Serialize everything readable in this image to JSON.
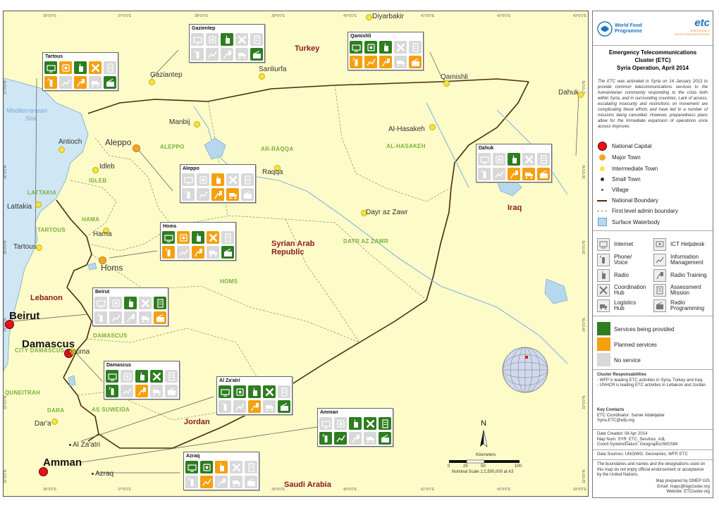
{
  "map": {
    "countries": {
      "turkey": "Turkey",
      "syria_1": "Syrian Arab",
      "syria_2": "Republic",
      "iraq": "Iraq",
      "lebanon": "Lebanon",
      "jordan": "Jordan",
      "saudi": "Saudi Arabia"
    },
    "sea_1": "Mediterranean",
    "sea_2": "Sea",
    "governorates": {
      "aleppo": "ALEPPO",
      "arraqqa": "AR-RAQQA",
      "alhasakeh": "AL-HASAKEH",
      "idleb": "IDLEB",
      "lattakia": "LATTAKIA",
      "hama": "HAMA",
      "tartous": "TARTOUS",
      "dayrazzawr": "DAYR AZ ZAWR",
      "homs": "HOMS",
      "damascus": "DAMASCUS",
      "citydamascus": "CITY DAMASCUS",
      "quneitrah": "QUNEITRAH",
      "dara": "DARA",
      "assuweida": "AS SUWEIDA"
    },
    "towns": {
      "diyarbakir": "Diyarbakir",
      "sanliurfa": "Sanliurfa",
      "gaziantep": "Gaziantep",
      "qamishli": "Qamishli",
      "dahuk": "Dahuk",
      "manbij": "Manbij",
      "alhasakeh": "Al-Hasakeh",
      "antioch": "Antioch",
      "aleppo": "Aleppo",
      "idleb": "Idleb",
      "raqqa": "Raqqa",
      "hama": "Hama",
      "lattakia": "Lattakia",
      "dayrazzawr": "Dayr az Zawr",
      "tartous": "Tartous",
      "homs": "Homs",
      "beirut": "Beirut",
      "damascus": "Damascus",
      "douma": "Douma",
      "dara": "Dar'a",
      "alzaatri": "Al Za'atri",
      "amman": "Amman",
      "azraq": "Azraq"
    },
    "coords": {
      "top": [
        "36°0'0\"E",
        "37°0'0\"E",
        "38°0'0\"E",
        "39°0'0\"E",
        "40°0'0\"E",
        "41°0'0\"E",
        "42°0'0\"E",
        "43°0'0\"E"
      ],
      "bottom": [
        "36°0'0\"E",
        "37°0'0\"E",
        "38°0'0\"E",
        "39°0'0\"E",
        "40°0'0\"E",
        "41°0'0\"E",
        "42°0'0\"E",
        "43°0'0\"E"
      ],
      "left": [
        "37°0'0\"N",
        "36°0'0\"N",
        "35°0'0\"N",
        "34°0'0\"N",
        "33°0'0\"N",
        "32°0'0\"N"
      ],
      "right": [
        "37°0'0\"N",
        "36°0'0\"N",
        "35°0'0\"N",
        "34°0'0\"N",
        "33°0'0\"N",
        "32°0'0\"N"
      ]
    },
    "north": "N",
    "scale_title": "Kilometers",
    "scale_ticks": [
      "0",
      "25",
      "50",
      "100"
    ],
    "scale_text": "Nominal Scale 1:2,500,000 at A3"
  },
  "hubs": [
    {
      "id": "gaziantep",
      "title": "Gazientep",
      "icons": [
        "n",
        "n",
        "g",
        "n",
        "n",
        "n",
        "n",
        "n",
        "n",
        "g"
      ]
    },
    {
      "id": "qamishli",
      "title": "Qamishli",
      "icons": [
        "g",
        "g",
        "g",
        "n",
        "n",
        "o",
        "o",
        "o",
        "n",
        "o"
      ]
    },
    {
      "id": "tartous",
      "title": "Tartous",
      "icons": [
        "g",
        "o",
        "g",
        "o",
        "n",
        "o",
        "n",
        "o",
        "n",
        "g"
      ]
    },
    {
      "id": "dahuk",
      "title": "Dahuk",
      "icons": [
        "n",
        "n",
        "g",
        "n",
        "n",
        "n",
        "n",
        "o",
        "o",
        "o"
      ]
    },
    {
      "id": "aleppo",
      "title": "Aleppo",
      "icons": [
        "n",
        "n",
        "o",
        "n",
        "n",
        "n",
        "n",
        "o",
        "o",
        "n"
      ]
    },
    {
      "id": "homs",
      "title": "Homs",
      "icons": [
        "g",
        "o",
        "g",
        "o",
        "n",
        "o",
        "n",
        "o",
        "n",
        "g"
      ]
    },
    {
      "id": "beirut",
      "title": "Beirut",
      "icons": [
        "n",
        "n",
        "g",
        "n",
        "g",
        "n",
        "n",
        "n",
        "n",
        "o"
      ]
    },
    {
      "id": "damascus",
      "title": "Damascus",
      "icons": [
        "g",
        "n",
        "g",
        "g",
        "n",
        "g",
        "n",
        "o",
        "n",
        "n"
      ]
    },
    {
      "id": "alzaatri",
      "title": "Al Za'atri",
      "icons": [
        "g",
        "g",
        "g",
        "g",
        "n",
        "n",
        "n",
        "o",
        "n",
        "g"
      ]
    },
    {
      "id": "amman",
      "title": "Amman",
      "icons": [
        "n",
        "n",
        "g",
        "g",
        "g",
        "g",
        "g",
        "n",
        "n",
        "g"
      ]
    },
    {
      "id": "azraq",
      "title": "Azraq",
      "icons": [
        "g",
        "g",
        "o",
        "n",
        "n",
        "n",
        "o",
        "n",
        "n",
        "n"
      ]
    }
  ],
  "panel": {
    "logo_wfp_1": "World Food",
    "logo_wfp_2": "Programme",
    "logo_etc": "etc",
    "logo_etc_sub": "EMERGENCY TELECOMMUNICATIONS",
    "title_1": "Emergency Telecommunications",
    "title_2": "Cluster (ETC)",
    "title_3": "Syria Operation, April 2014",
    "intro": "The ETC was activated in Syria on 14 January 2013 to provide common telecommunications services to the humanitarian community responding to the crisis both within Syria, and in surrounding countries. Lack of access, escalating insecurity and restrictions on movement are complicating these efforts and have led to a number of missions being cancelled. However, preparedness plans allow for the immediate expansion of operations once access improves.",
    "legend": {
      "capital": "National Capital",
      "major": "Major Town",
      "intermediate": "Intermediate Town",
      "small": "Small Town",
      "village": "Village",
      "boundary": "National Boundary",
      "admin": "First level admin boundary",
      "water": "Surface Waterbody"
    },
    "services": {
      "internet": "Internet",
      "helpdesk": "ICT Helpdesk",
      "phone_1": "Phone/",
      "phone_2": "Voice",
      "infomgmt_1": "Information",
      "infomgmt_2": "Management",
      "radio": "Radio",
      "radiotraining": "Radio Training",
      "coord_1": "Coordination",
      "coord_2": "Hub",
      "assess_1": "Assessment",
      "assess_2": "Mission",
      "logistics_1": "Logistics",
      "logistics_2": "Hub",
      "radioprog_1": "Radio",
      "radioprog_2": "Programming"
    },
    "status": {
      "provided": "Services being provided",
      "planned": "Planned services",
      "none": "No service"
    },
    "colors": {
      "provided": "#2e7d1f",
      "planned": "#f5a00f",
      "none": "#d8d8d8"
    },
    "resp_title": "Cluster Responsabilities",
    "resp_1": "- WFP is leading ETC activities in Syria, Turkey and Iraq.",
    "resp_2": "- UNHCR is leading ETC activities in Lebanon and Jordan.",
    "contacts_title": "Key Contacts",
    "contacts_1": "ETC Coordinator: Samer Abdeljaber",
    "contacts_2": "Syria.ETC@wfp.org",
    "created": "Date Created: 08 Apr 2014",
    "mapnum": "Map Num: SYR_ETC_Services_A3L",
    "coordsys": "Coord.System/Datum: Geographic/WGS84",
    "sources": "Data Sources: UNGIWG, Geonames, WFP, ETC",
    "disclaimer": "The boundaries and names and the designations used on this map do not imply official endorsement or acceptance by the United Nations.",
    "prepared": "Map prepared by OMEP GIS",
    "email": "Email: maps@logcluster.org",
    "website": "Website: ETCluster.org"
  }
}
